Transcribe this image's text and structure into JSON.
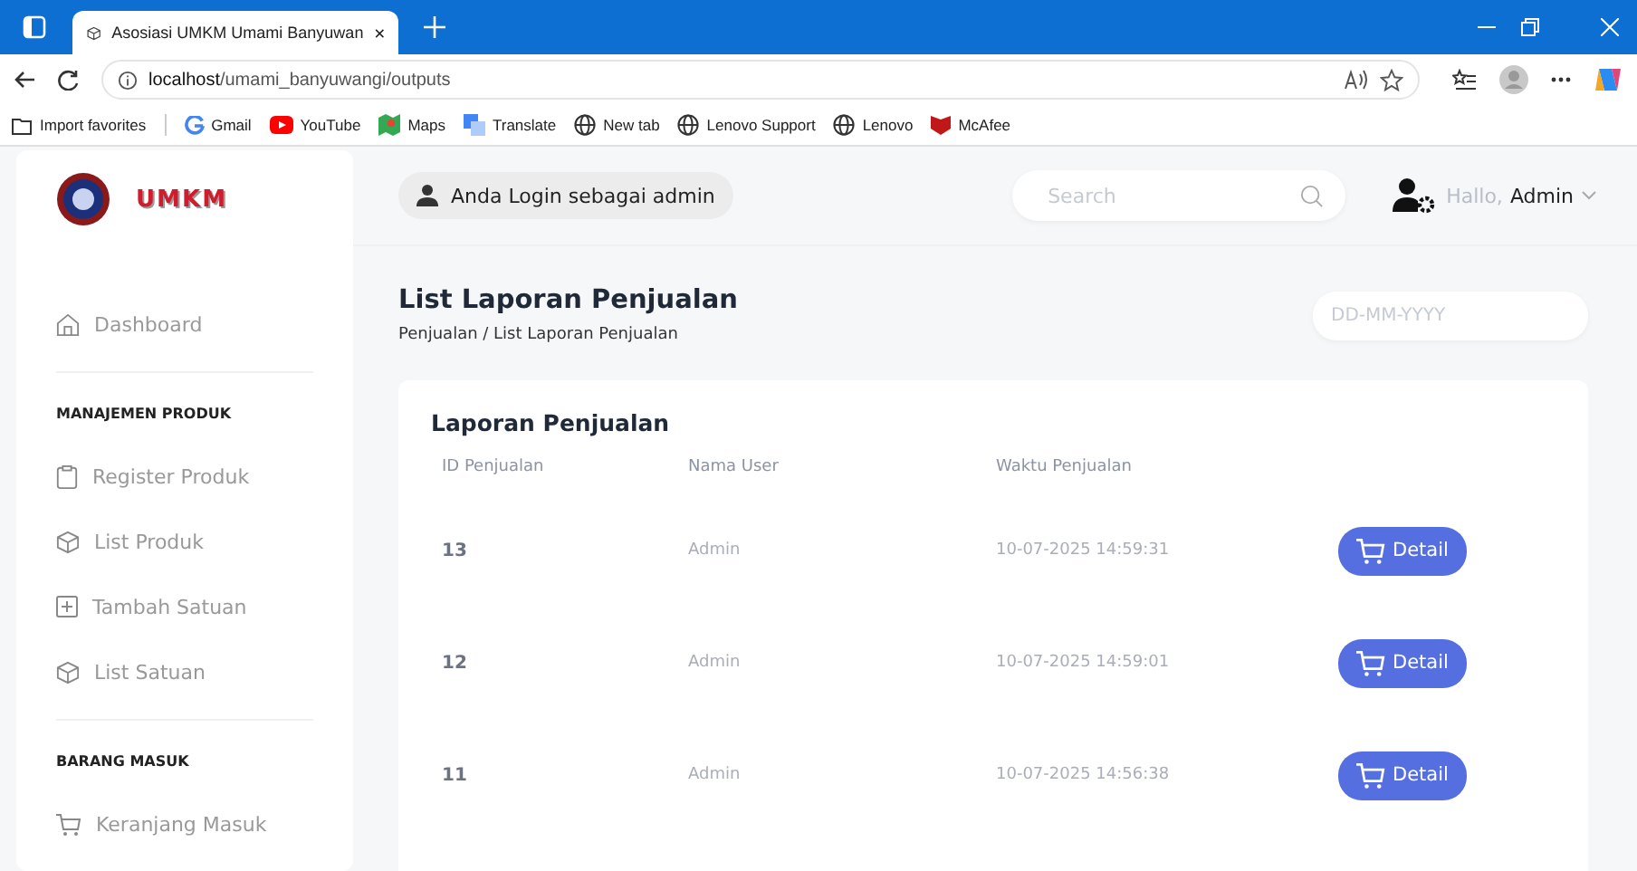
{
  "browser": {
    "tab_title": "Asosiasi UMKM Umami Banyuwan",
    "url_host": "localhost",
    "url_path": "/umami_banyuwangi/outputs",
    "bookmarks": [
      {
        "label": "Import favorites",
        "kind": "import"
      },
      {
        "label": "Gmail",
        "kind": "google"
      },
      {
        "label": "YouTube",
        "kind": "youtube"
      },
      {
        "label": "Maps",
        "kind": "maps"
      },
      {
        "label": "Translate",
        "kind": "translate"
      },
      {
        "label": "New tab",
        "kind": "globe"
      },
      {
        "label": "Lenovo Support",
        "kind": "globe"
      },
      {
        "label": "Lenovo",
        "kind": "globe"
      },
      {
        "label": "McAfee",
        "kind": "mcafee"
      }
    ]
  },
  "sidebar": {
    "logo_text": "UMKM",
    "sections": [
      {
        "items": [
          {
            "label": "Dashboard",
            "kind": "home"
          }
        ]
      },
      {
        "heading": "MANAJEMEN PRODUK",
        "items": [
          {
            "label": "Register Produk",
            "kind": "clipboard"
          },
          {
            "label": "List Produk",
            "kind": "box"
          },
          {
            "label": "Tambah Satuan",
            "kind": "plus"
          },
          {
            "label": "List Satuan",
            "kind": "box"
          }
        ]
      },
      {
        "heading": "BARANG MASUK",
        "items": [
          {
            "label": "Keranjang Masuk",
            "kind": "cart"
          }
        ]
      }
    ]
  },
  "header": {
    "login_badge": "Anda Login sebagai admin",
    "search": {
      "placeholder": "Search"
    },
    "greeting": "Hallo,",
    "user": "Admin"
  },
  "page": {
    "title": "List Laporan Penjualan",
    "breadcrumb": "Penjualan / List Laporan Penjualan",
    "date_filter": {
      "placeholder": "DD-MM-YYYY"
    }
  },
  "table": {
    "title": "Laporan Penjualan",
    "columns": [
      "ID Penjualan",
      "Nama User",
      "Waktu Penjualan"
    ],
    "rows": [
      {
        "id": "13",
        "user": "Admin",
        "time": "10-07-2025 14:59:31",
        "action": "Detail"
      },
      {
        "id": "12",
        "user": "Admin",
        "time": "10-07-2025 14:59:01",
        "action": "Detail"
      },
      {
        "id": "11",
        "user": "Admin",
        "time": "10-07-2025 14:56:38",
        "action": "Detail"
      }
    ]
  }
}
